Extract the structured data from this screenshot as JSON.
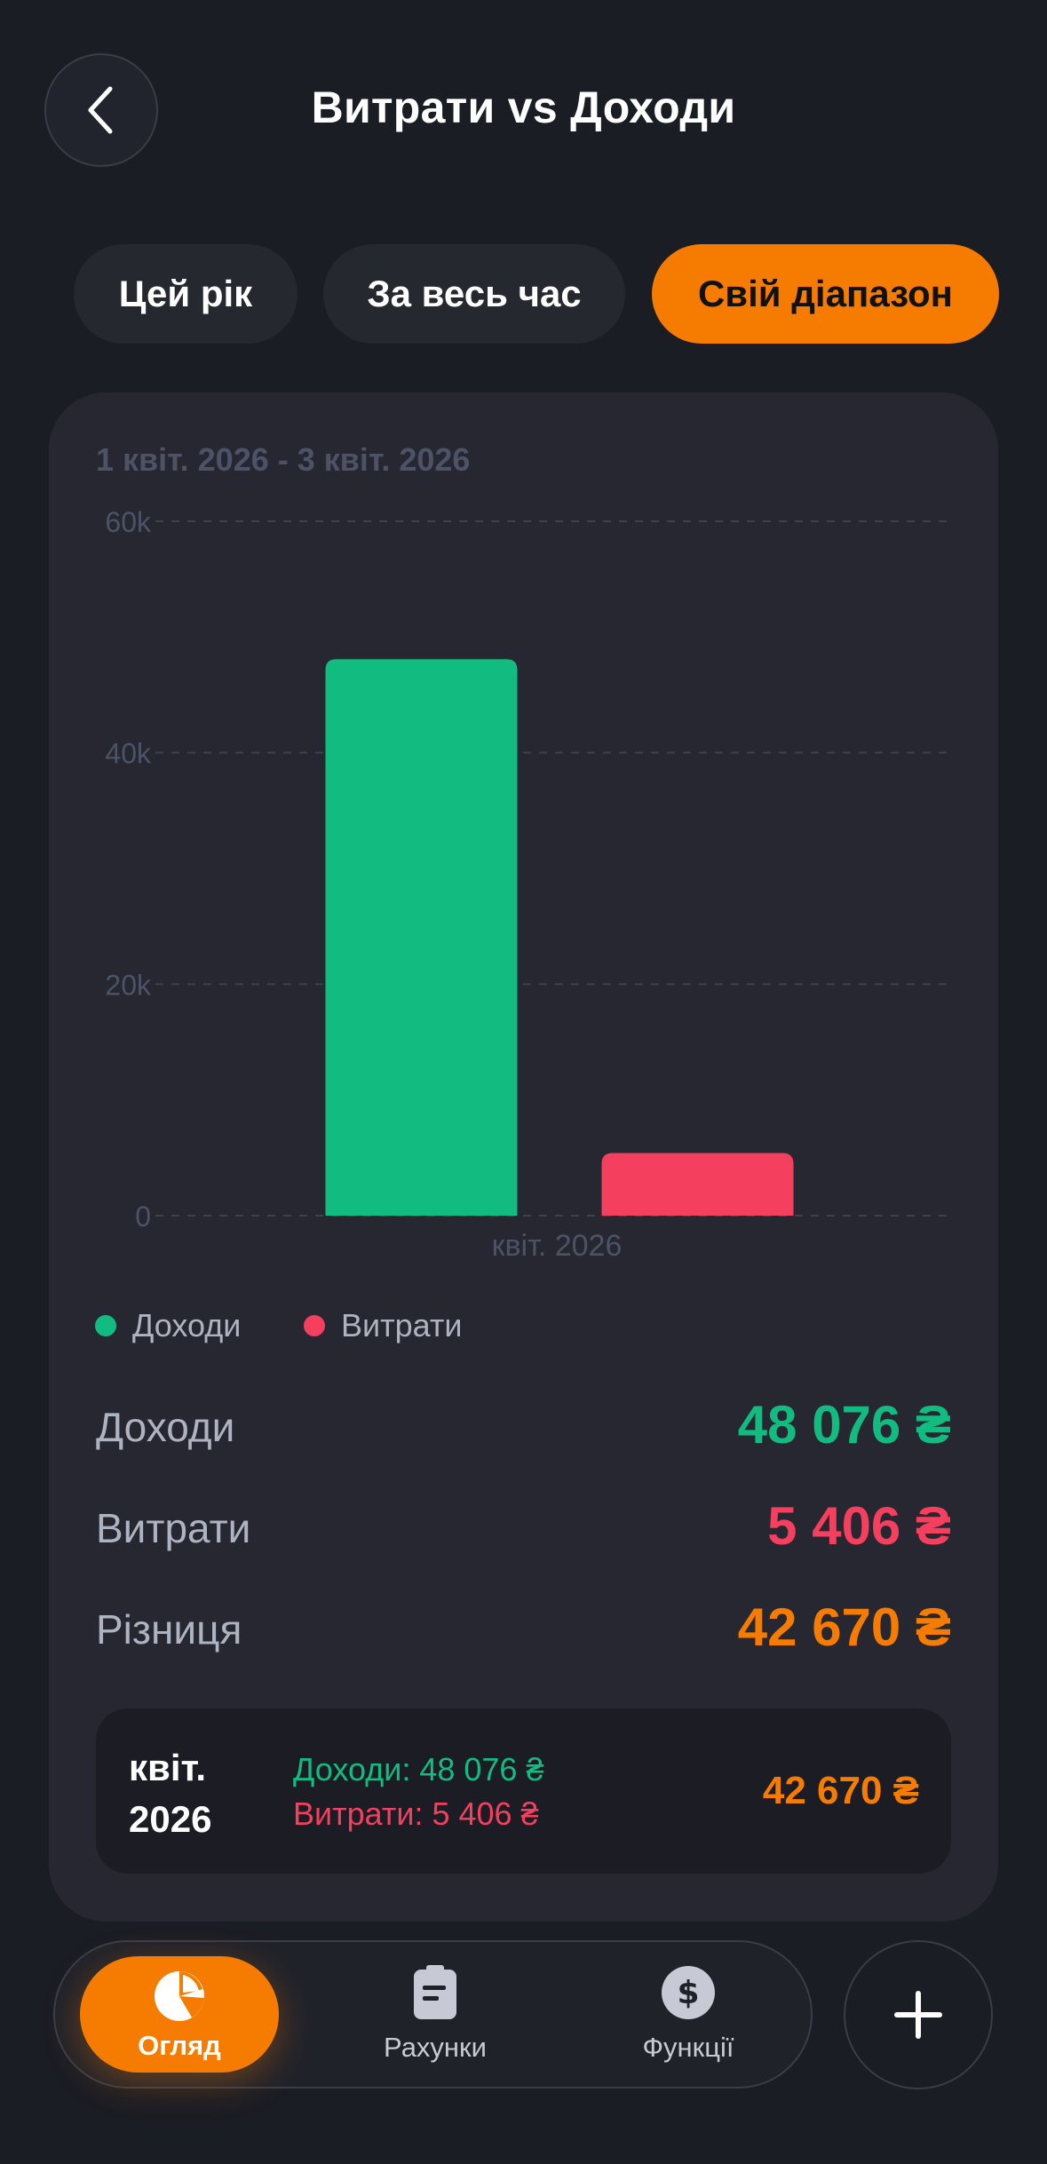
{
  "header": {
    "title": "Витрати vs Доходи",
    "back_icon": "chevron-left-icon"
  },
  "filters": [
    {
      "label": "Цей рік",
      "active": false
    },
    {
      "label": "За весь час",
      "active": false
    },
    {
      "label": "Свій діапазон",
      "active": true
    }
  ],
  "card": {
    "range_label": "1 квіт. 2026 - 3 квіт. 2026"
  },
  "chart_data": {
    "type": "bar",
    "categories": [
      "квіт. 2026"
    ],
    "series": [
      {
        "name": "Доходи",
        "values": [
          48076
        ],
        "color": "#12bb7f"
      },
      {
        "name": "Витрати",
        "values": [
          5406
        ],
        "color": "#f43f5e"
      }
    ],
    "ylim": [
      0,
      60000
    ],
    "yticks": [
      "0",
      "20k",
      "40k",
      "60k"
    ],
    "grid": true,
    "legend_position": "bottom-left"
  },
  "legend": {
    "income": "Доходи",
    "expense": "Витрати"
  },
  "summary": {
    "income_label": "Доходи",
    "income_value": "48 076 ₴",
    "expense_label": "Витрати",
    "expense_value": "5 406 ₴",
    "diff_label": "Різниця",
    "diff_value": "42 670 ₴"
  },
  "month_row": {
    "month": "квіт. 2026",
    "income_text": "Доходи: 48 076 ₴",
    "expense_text": "Витрати: 5 406 ₴",
    "diff": "42 670 ₴"
  },
  "tabbar": {
    "overview": {
      "label": "Огляд",
      "icon": "pie-chart-icon",
      "active": true
    },
    "accounts": {
      "label": "Рахунки",
      "icon": "clipboard-icon",
      "active": false
    },
    "functions": {
      "label": "Функції",
      "icon": "dollar-icon",
      "active": false
    },
    "add_icon": "plus-icon"
  },
  "colors": {
    "accent": "#f57c00",
    "income": "#12bb7f",
    "expense": "#f43f5e",
    "background": "#1b1d24",
    "card": "#262730"
  }
}
